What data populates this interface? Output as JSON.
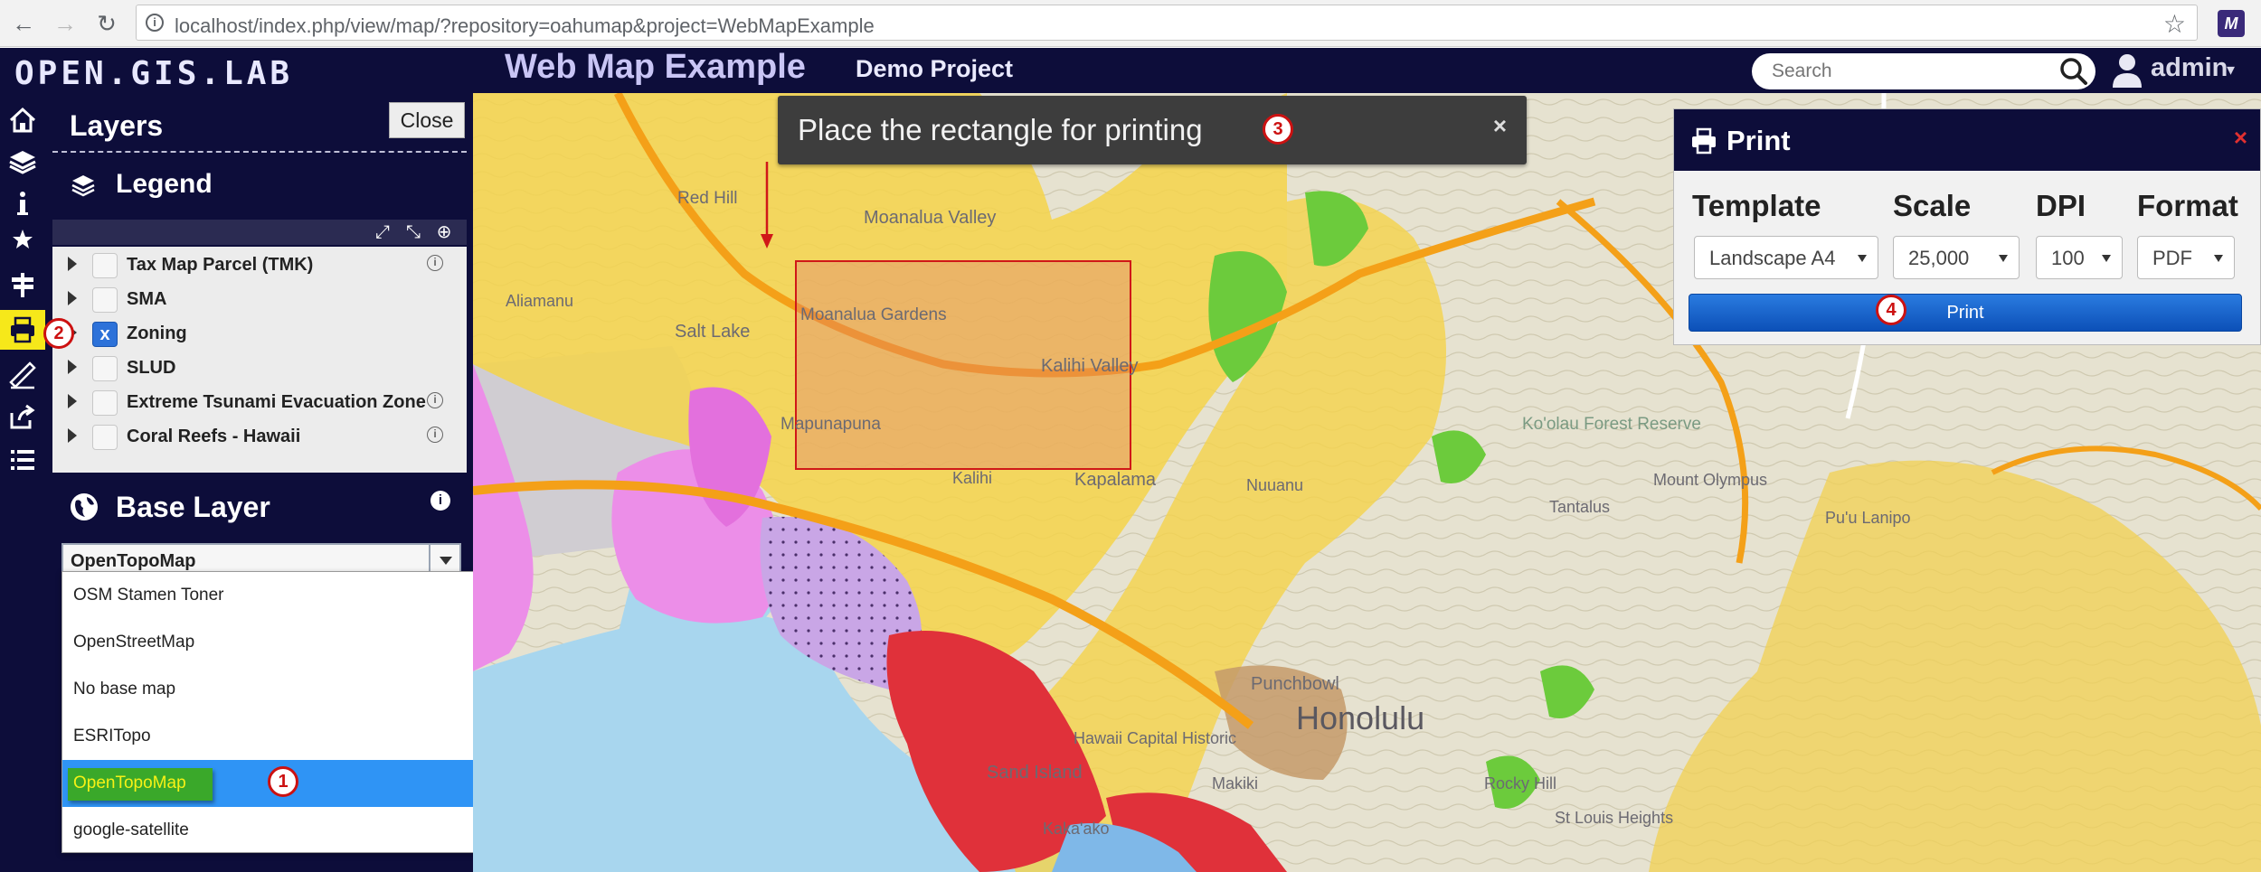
{
  "browser": {
    "url": "localhost/index.php/view/map/?repository=oahumap&project=WebMapExample",
    "back": "←",
    "forward": "→",
    "reload": "↻",
    "info": "i",
    "star": "☆",
    "extension": "M"
  },
  "header": {
    "logo": "OPEN.GIS.LAB",
    "title": "Web Map Example",
    "project": "Demo Project",
    "search_placeholder": "Search",
    "user": "admin",
    "user_caret": "▾"
  },
  "layers": {
    "title": "Layers",
    "close_label": "Close",
    "legend_title": "Legend",
    "legend_tools": [
      "⤢",
      "⤡",
      "⊕"
    ],
    "items": [
      {
        "label": "Tax Map Parcel (TMK)",
        "checked": false,
        "info": true
      },
      {
        "label": "SMA",
        "checked": false,
        "info": false
      },
      {
        "label": "Zoning",
        "checked": true,
        "info": false
      },
      {
        "label": "SLUD",
        "checked": false,
        "info": false
      },
      {
        "label": "Extreme Tsunami Evacuation Zone",
        "checked": false,
        "info": true
      },
      {
        "label": "Coral Reefs - Hawaii",
        "checked": false,
        "info": true
      }
    ],
    "check_mark": "x",
    "info_mark": "i"
  },
  "base_layer": {
    "title": "Base Layer",
    "info_mark": "i",
    "selected": "OpenTopoMap",
    "options": [
      "OSM Stamen Toner",
      "OpenStreetMap",
      "No base map",
      "ESRITopo",
      "OpenTopoMap",
      "google-satellite"
    ],
    "selected_index": 4
  },
  "tooltip": {
    "text": "Place the rectangle for printing",
    "close": "×"
  },
  "print": {
    "title": "Print",
    "close": "×",
    "columns": {
      "template": "Template",
      "scale": "Scale",
      "dpi": "DPI",
      "format": "Format"
    },
    "values": {
      "template": "Landscape A4",
      "scale": "25,000",
      "dpi": "100",
      "format": "PDF"
    },
    "button": "Print"
  },
  "map_labels": {
    "moanalua_valley": "Moanalua Valley",
    "red_hill": "Red Hill",
    "salt_lake": "Salt Lake",
    "moanalua_gardens": "Moanalua Gardens",
    "mapunapuna": "Mapunapuna",
    "kalihi_valley": "Kalihi Valley",
    "kalihi": "Kalihi",
    "kapalama": "Kapalama",
    "nuuanu": "Nuuanu",
    "punchbowl": "Punchbowl",
    "honolulu": "Honolulu",
    "sand_island": "Sand Island",
    "kakaako": "Kaka'ako",
    "makiki": "Makiki",
    "tantalus": "Tantalus",
    "mount_olympus": "Mount Olympus",
    "pu_u_lanipo": "Pu'u Lanipo",
    "st_louis_heights": "St Louis Heights",
    "rocky_hill": "Rocky Hill",
    "hawaii_capital_historic": "Hawaii Capital Historic",
    "iolani_park": "Aliamanu",
    "koolau_forest": "Ko'olau Forest Reserve"
  },
  "badges": [
    "1",
    "2",
    "3",
    "4"
  ],
  "colors": {
    "header_bg": "#0d0d3a",
    "active_tool": "#f6e81a",
    "print_button": "#1565c8",
    "badge": "#cc1111"
  }
}
